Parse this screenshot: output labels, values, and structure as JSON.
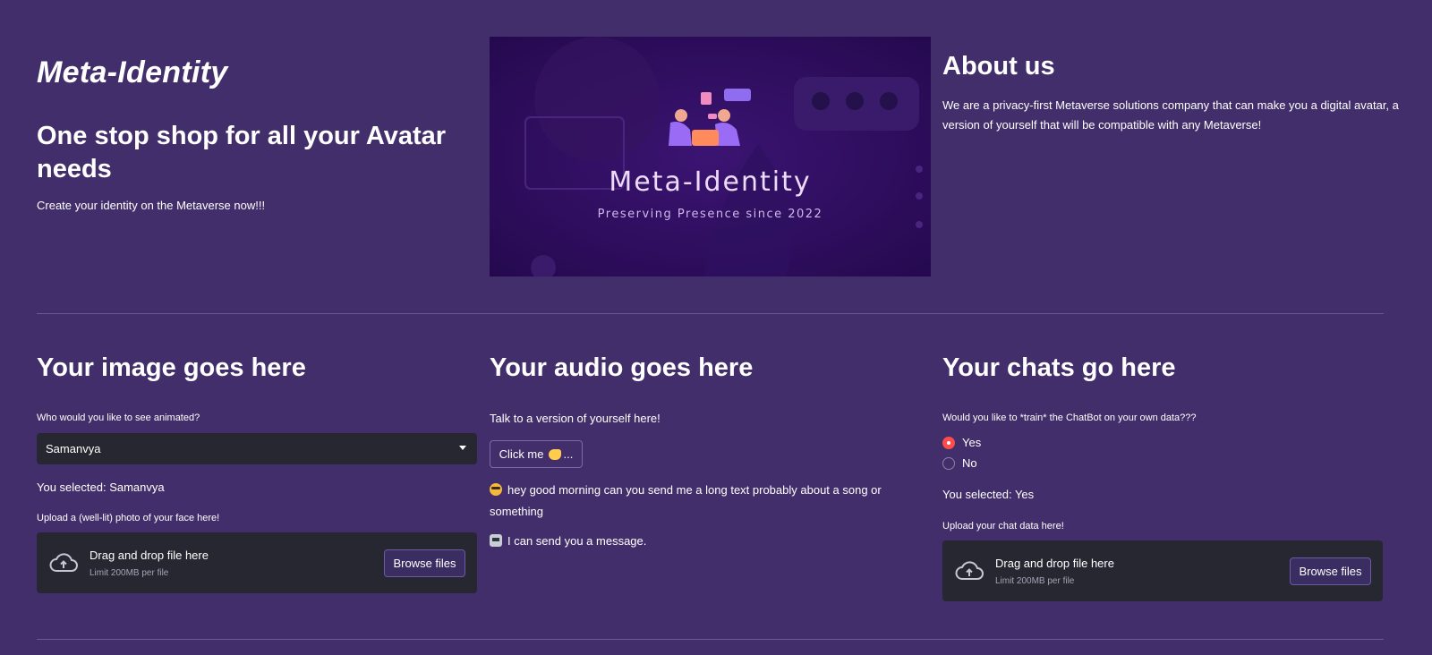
{
  "hero": {
    "title": "Meta-Identity",
    "subtitle": "One stop shop for all your Avatar needs",
    "description": "Create your identity on the Metaverse now!!!"
  },
  "banner": {
    "title": "Meta-Identity",
    "tagline": "Preserving Presence since 2022"
  },
  "about": {
    "heading": "About us",
    "text": "We are a privacy-first Metaverse solutions company that can make you a digital avatar, a version of yourself that will be compatible with any Metaverse!"
  },
  "image_section": {
    "heading": "Your image goes here",
    "select_label": "Who would you like to see animated?",
    "select_value": "Samanvya",
    "selected_text": "You selected: Samanvya",
    "upload_label": "Upload a (well-lit) photo of your face here!",
    "uploader": {
      "drag_text": "Drag and drop file here",
      "limit_text": "Limit 200MB per file",
      "button_label": "Browse files"
    }
  },
  "audio_section": {
    "heading": "Your audio goes here",
    "intro": "Talk to a version of yourself here!",
    "button_label": "Click me",
    "button_suffix": "...",
    "messages": [
      {
        "icon": "smiling-face-with-sunglasses-icon",
        "text": "hey good morning can you send me a long text probably about a song or something"
      },
      {
        "icon": "robot-icon",
        "text": "I can send you a message."
      }
    ]
  },
  "chat_section": {
    "heading": "Your chats go here",
    "question": "Would you like to *train* the ChatBot on your own data???",
    "options": [
      "Yes",
      "No"
    ],
    "selected_option": "Yes",
    "selected_text": "You selected: Yes",
    "upload_label": "Upload your chat data here!",
    "uploader": {
      "drag_text": "Drag and drop file here",
      "limit_text": "Limit 200MB per file",
      "button_label": "Browse files"
    }
  },
  "colors": {
    "background": "#422e6a",
    "widget": "#262730",
    "accent_radio": "#ff4b4b"
  }
}
